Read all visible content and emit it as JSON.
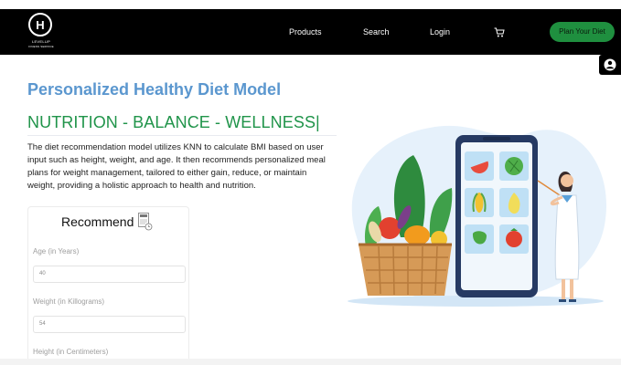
{
  "navbar": {
    "logo_text_line1": "LEVELUP",
    "logo_text_line2": "FINESS SERVICE",
    "products": "Products",
    "search": "Search",
    "login": "Login",
    "cta": "Plan Your Diet"
  },
  "hero": {
    "title": "Personalized Healthy Diet Model",
    "subtitle": "NUTRITION - BALANCE - WELLNESS|",
    "description": "The diet recommendation model utilizes KNN to calculate BMI based on user input such as height, weight, and age. It then recommends personalized meal plans for weight management, tailored to either gain, reduce, or maintain weight, providing a holistic approach to health and nutrition."
  },
  "form": {
    "title": "Recommend",
    "age_label": "Age (in Years)",
    "age_value": "40",
    "weight_label": "Weight (in Killograms)",
    "weight_value": "54",
    "height_label": "Height (in Centimeters)"
  },
  "icons": [
    "cart-icon",
    "user-icon",
    "diet-icon"
  ],
  "colors": {
    "accent_green": "#1f8f3f",
    "title_blue": "#5b97cf",
    "subtitle_green": "#20944a"
  }
}
